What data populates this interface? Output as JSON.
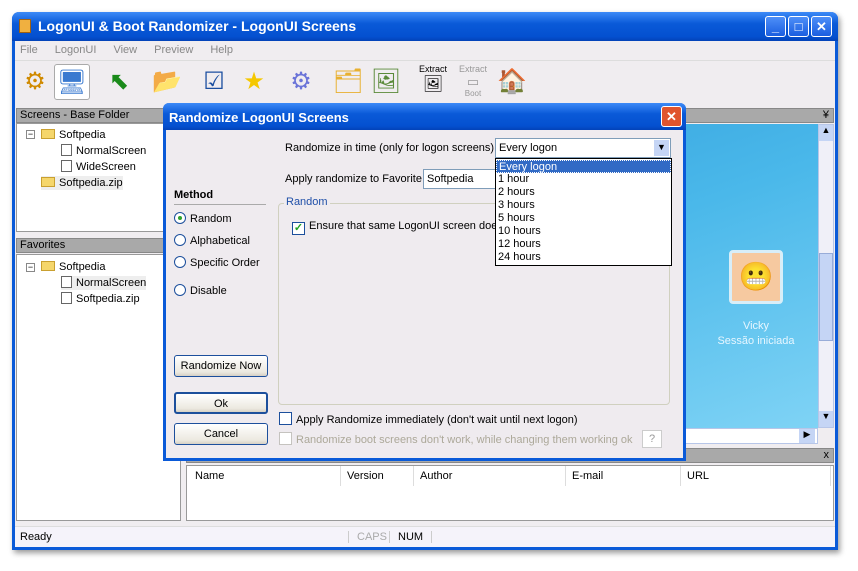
{
  "window": {
    "title": "LogonUI & Boot Randomizer - LogonUI Screens",
    "minimize": "_",
    "maximize": "□",
    "close": "✕"
  },
  "menu": [
    "File",
    "LogonUI",
    "View",
    "Preview",
    "Help"
  ],
  "toolbar": {
    "extract_label": "Extract",
    "extract_boot_label": "Extract",
    "extract_boot_sub": "Boot"
  },
  "screens_panel": {
    "header": "Screens - Base Folder",
    "root": "Softpedia",
    "children": [
      "NormalScreen",
      "WideScreen"
    ],
    "zip": "Softpedia.zip"
  },
  "favorites_panel": {
    "header": "Favorites",
    "root": "Softpedia",
    "children": [
      "NormalScreen",
      "Softpedia.zip"
    ]
  },
  "preview": {
    "pin": "¥",
    "user_name": "Vicky",
    "user_status": "Sessão iniciada"
  },
  "details": {
    "close": "x",
    "columns": [
      "Name",
      "Version",
      "Author",
      "E-mail",
      "URL"
    ]
  },
  "status": {
    "text": "Ready",
    "caps": "CAPS",
    "num": "NUM"
  },
  "dialog": {
    "title": "Randomize LogonUI Screens",
    "close": "✕",
    "method_label": "Method",
    "methods": [
      "Random",
      "Alphabetical",
      "Specific Order",
      "Disable"
    ],
    "selected_method": "Random",
    "time_label": "Randomize in time (only for logon screens)",
    "time_value": "Every logon",
    "time_options": [
      "Every logon",
      "1 hour",
      "2 hours",
      "3 hours",
      "5 hours",
      "10 hours",
      "12 hours",
      "24 hours"
    ],
    "favorite_label": "Apply randomize to Favorite",
    "favorite_value": "Softpedia",
    "group_label": "Random",
    "ensure_label": "Ensure that same LogonUI screen does",
    "apply_now_label": "Apply Randomize immediately (don't wait until next logon)",
    "boot_label": "Randomize boot screens don't work, while changing them working ok",
    "help": "?",
    "randomize_now": "Randomize Now",
    "ok": "Ok",
    "cancel": "Cancel"
  }
}
